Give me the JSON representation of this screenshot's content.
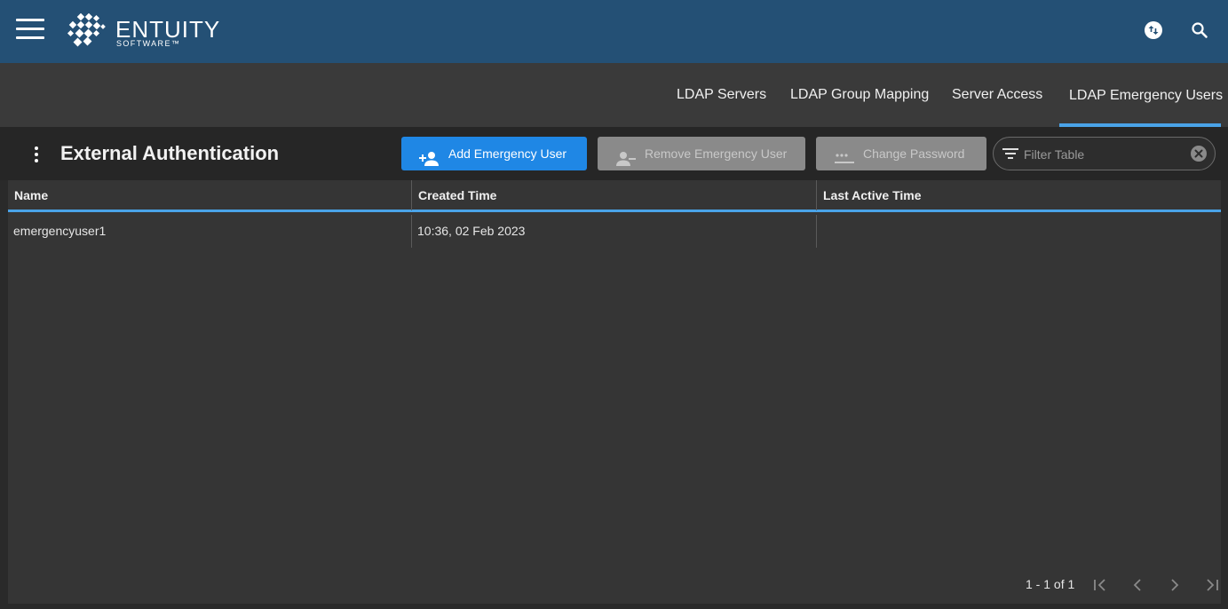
{
  "header": {
    "brand": "ENTUITY",
    "brand_sub": "SOFTWARE™",
    "icons": [
      "menu-icon",
      "entuity-logo",
      "swap-icon",
      "search-icon"
    ]
  },
  "tabs": [
    {
      "label": "LDAP Servers",
      "active": false
    },
    {
      "label": "LDAP Group Mapping",
      "active": false
    },
    {
      "label": "Server Access",
      "active": false
    },
    {
      "label": "LDAP Emergency Users",
      "active": true
    }
  ],
  "toolbar": {
    "title": "External Authentication",
    "add_label": "Add Emergency User",
    "remove_label": "Remove Emergency User",
    "change_pw_label": "Change Password",
    "filter_placeholder": "Filter Table",
    "filter_value": ""
  },
  "table": {
    "columns": [
      "Name",
      "Created Time",
      "Last Active Time"
    ],
    "rows": [
      {
        "name": "emergencyuser1",
        "created": "10:36, 02 Feb 2023",
        "last_active": ""
      }
    ]
  },
  "pagination": {
    "summary": "1 - 1 of 1"
  },
  "colors": {
    "header_bg": "#245075",
    "accent": "#4aa3e8",
    "primary_button": "#1f87e5",
    "disabled_button": "#8a8a8a"
  }
}
